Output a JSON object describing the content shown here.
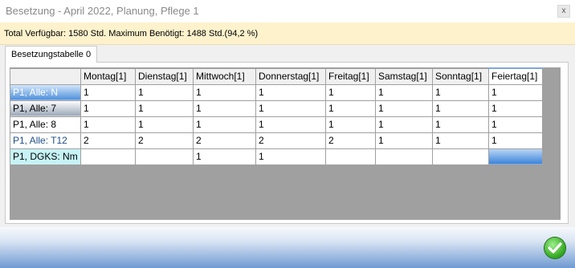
{
  "window": {
    "title": "Besetzung - April 2022, Planung, Pflege 1",
    "close_label": "x"
  },
  "info": {
    "text": "Total Verfügbar: 1580 Std.  Maximum Benötigt: 1488 Std.(94,2 %)"
  },
  "tabs": [
    {
      "label": "Besetzungstabelle 0"
    }
  ],
  "table": {
    "columns": [
      "Montag[1]",
      "Dienstag[1]",
      "Mittwoch[1]",
      "Donnerstag[1]",
      "Freitag[1]",
      "Samstag[1]",
      "Sonntag[1]",
      "Feiertag[1]"
    ],
    "rows": [
      {
        "label": "P1, Alle: N",
        "cells": [
          "1",
          "1",
          "1",
          "1",
          "1",
          "1",
          "1",
          "1"
        ]
      },
      {
        "label": "P1, Alle: 7",
        "cells": [
          "1",
          "1",
          "1",
          "1",
          "1",
          "1",
          "1",
          "1"
        ]
      },
      {
        "label": "P1, Alle: 8",
        "cells": [
          "1",
          "1",
          "1",
          "1",
          "1",
          "1",
          "1",
          "1"
        ]
      },
      {
        "label": "P1, Alle: T12",
        "cells": [
          "2",
          "2",
          "2",
          "2",
          "2",
          "1",
          "1",
          "1"
        ]
      },
      {
        "label": "P1, DGKS: Nm",
        "cells": [
          "",
          "",
          "1",
          "1",
          "",
          "",
          "",
          ""
        ]
      }
    ]
  },
  "colors": {
    "info_background": "#fdf2cc",
    "grid_background": "#a0a0a0",
    "selection_blue": "#4e8fdb",
    "ok_green": "#2fa51c"
  },
  "icons": {
    "close": "close-icon",
    "ok": "checkmark-icon"
  }
}
